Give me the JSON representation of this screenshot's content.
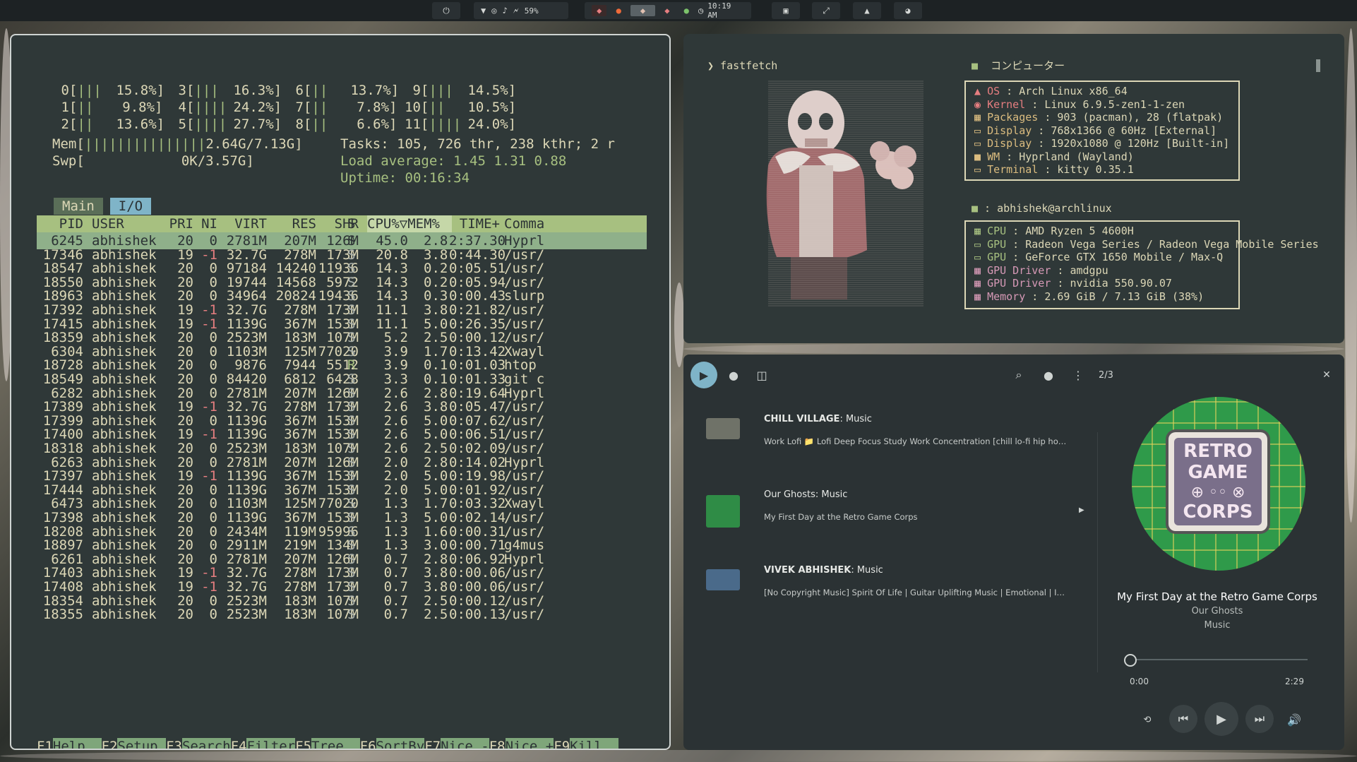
{
  "topbar": {
    "battery": "59%",
    "clock": "10:19 AM"
  },
  "htop": {
    "cpus": [
      {
        "id": "0",
        "bars": "|||",
        "pct": "15.8%]"
      },
      {
        "id": "1",
        "bars": "||",
        "pct": "9.8%]"
      },
      {
        "id": "2",
        "bars": "||",
        "pct": "13.6%]"
      },
      {
        "id": "3",
        "bars": "|||",
        "pct": "16.3%]"
      },
      {
        "id": "4",
        "bars": "||||",
        "pct": "24.2%]"
      },
      {
        "id": "5",
        "bars": "||||",
        "pct": "27.7%]"
      },
      {
        "id": "6",
        "bars": "||",
        "pct": "13.7%]"
      },
      {
        "id": "7",
        "bars": "||",
        "pct": "7.8%]"
      },
      {
        "id": "8",
        "bars": "||",
        "pct": "6.6%]"
      },
      {
        "id": "9",
        "bars": "|||",
        "pct": "14.5%]"
      },
      {
        "id": "10",
        "bars": "||",
        "pct": "10.5%]"
      },
      {
        "id": "11",
        "bars": "||||",
        "pct": "24.0%]"
      }
    ],
    "mem": {
      "label": "Mem[",
      "bars": "|||||||||||||||",
      "value": "2.64G/7.13G]"
    },
    "swp": {
      "label": "Swp[",
      "value": "0K/3.57G]"
    },
    "tasks": "Tasks: 105, 726 thr, 238 kthr; 2 r",
    "load": "Load average: 1.45 1.31 0.88",
    "uptime": "Uptime: 00:16:34",
    "tabs": [
      "Main",
      "I/O"
    ],
    "headers": [
      "PID",
      "USER",
      "PRI",
      "NI",
      "VIRT",
      "RES",
      "SHR",
      "S",
      "CPU%▽MEM%",
      "TIME+",
      "Comma"
    ],
    "rows": [
      [
        "6245",
        "abhishek",
        "20",
        "0",
        "2781M",
        "207M",
        "126M",
        "S",
        "45.0",
        "2.8",
        "2:37.30",
        "Hyprl"
      ],
      [
        "17346",
        "abhishek",
        "19",
        "-1",
        "32.7G",
        "278M",
        "173M",
        "S",
        "20.8",
        "3.8",
        "0:44.30",
        "/usr/"
      ],
      [
        "18547",
        "abhishek",
        "20",
        "0",
        "97184",
        "14240",
        "11936",
        "S",
        "14.3",
        "0.2",
        "0:05.51",
        "/usr/"
      ],
      [
        "18550",
        "abhishek",
        "20",
        "0",
        "19744",
        "14568",
        "5972",
        "S",
        "14.3",
        "0.2",
        "0:05.94",
        "/usr/"
      ],
      [
        "18963",
        "abhishek",
        "20",
        "0",
        "34964",
        "20824",
        "19436",
        "S",
        "14.3",
        "0.3",
        "0:00.43",
        "slurp"
      ],
      [
        "17392",
        "abhishek",
        "19",
        "-1",
        "32.7G",
        "278M",
        "173M",
        "S",
        "11.1",
        "3.8",
        "0:21.82",
        "/usr/"
      ],
      [
        "17415",
        "abhishek",
        "19",
        "-1",
        "1139G",
        "367M",
        "153M",
        "S",
        "11.1",
        "5.0",
        "0:26.35",
        "/usr/"
      ],
      [
        "18359",
        "abhishek",
        "20",
        "0",
        "2523M",
        "183M",
        "107M",
        "S",
        "5.2",
        "2.5",
        "0:00.12",
        "/usr/"
      ],
      [
        "6304",
        "abhishek",
        "20",
        "0",
        "1103M",
        "125M",
        "77020",
        "S",
        "3.9",
        "1.7",
        "0:13.42",
        "Xwayl"
      ],
      [
        "18728",
        "abhishek",
        "20",
        "0",
        "9876",
        "7944",
        "5512",
        "R",
        "3.9",
        "0.1",
        "0:01.03",
        "htop"
      ],
      [
        "18549",
        "abhishek",
        "20",
        "0",
        "84420",
        "6812",
        "6428",
        "S",
        "3.3",
        "0.1",
        "0:01.33",
        "git c"
      ],
      [
        "6282",
        "abhishek",
        "20",
        "0",
        "2781M",
        "207M",
        "126M",
        "S",
        "2.6",
        "2.8",
        "0:19.64",
        "Hyprl"
      ],
      [
        "17389",
        "abhishek",
        "19",
        "-1",
        "32.7G",
        "278M",
        "173M",
        "S",
        "2.6",
        "3.8",
        "0:05.47",
        "/usr/"
      ],
      [
        "17399",
        "abhishek",
        "20",
        "0",
        "1139G",
        "367M",
        "153M",
        "S",
        "2.6",
        "5.0",
        "0:07.62",
        "/usr/"
      ],
      [
        "17400",
        "abhishek",
        "19",
        "-1",
        "1139G",
        "367M",
        "153M",
        "S",
        "2.6",
        "5.0",
        "0:06.51",
        "/usr/"
      ],
      [
        "18318",
        "abhishek",
        "20",
        "0",
        "2523M",
        "183M",
        "107M",
        "S",
        "2.6",
        "2.5",
        "0:02.09",
        "/usr/"
      ],
      [
        "6263",
        "abhishek",
        "20",
        "0",
        "2781M",
        "207M",
        "126M",
        "S",
        "2.0",
        "2.8",
        "0:14.02",
        "Hyprl"
      ],
      [
        "17397",
        "abhishek",
        "19",
        "-1",
        "1139G",
        "367M",
        "153M",
        "S",
        "2.0",
        "5.0",
        "0:19.98",
        "/usr/"
      ],
      [
        "17444",
        "abhishek",
        "20",
        "0",
        "1139G",
        "367M",
        "153M",
        "S",
        "2.0",
        "5.0",
        "0:01.92",
        "/usr/"
      ],
      [
        "6473",
        "abhishek",
        "20",
        "0",
        "1103M",
        "125M",
        "77020",
        "S",
        "1.3",
        "1.7",
        "0:03.32",
        "Xwayl"
      ],
      [
        "17398",
        "abhishek",
        "20",
        "0",
        "1139G",
        "367M",
        "153M",
        "S",
        "1.3",
        "5.0",
        "0:02.14",
        "/usr/"
      ],
      [
        "18208",
        "abhishek",
        "20",
        "0",
        "2434M",
        "119M",
        "95996",
        "S",
        "1.3",
        "1.6",
        "0:00.31",
        "/usr/"
      ],
      [
        "18897",
        "abhishek",
        "20",
        "0",
        "2911M",
        "219M",
        "134M",
        "S",
        "1.3",
        "3.0",
        "0:00.71",
        "g4mus"
      ],
      [
        "6261",
        "abhishek",
        "20",
        "0",
        "2781M",
        "207M",
        "126M",
        "S",
        "0.7",
        "2.8",
        "0:06.92",
        "Hyprl"
      ],
      [
        "17403",
        "abhishek",
        "19",
        "-1",
        "32.7G",
        "278M",
        "173M",
        "S",
        "0.7",
        "3.8",
        "0:00.06",
        "/usr/"
      ],
      [
        "17408",
        "abhishek",
        "19",
        "-1",
        "32.7G",
        "278M",
        "173M",
        "S",
        "0.7",
        "3.8",
        "0:00.06",
        "/usr/"
      ],
      [
        "18354",
        "abhishek",
        "20",
        "0",
        "2523M",
        "183M",
        "107M",
        "S",
        "0.7",
        "2.5",
        "0:00.12",
        "/usr/"
      ],
      [
        "18355",
        "abhishek",
        "20",
        "0",
        "2523M",
        "183M",
        "107M",
        "S",
        "0.7",
        "2.5",
        "0:00.13",
        "/usr/"
      ]
    ],
    "fkeys": [
      {
        "k": "F1",
        "l": "Help  "
      },
      {
        "k": "F2",
        "l": "Setup "
      },
      {
        "k": "F3",
        "l": "Search"
      },
      {
        "k": "F4",
        "l": "Filter"
      },
      {
        "k": "F5",
        "l": "Tree  "
      },
      {
        "k": "F6",
        "l": "SortBy"
      },
      {
        "k": "F7",
        "l": "Nice -"
      },
      {
        "k": "F8",
        "l": "Nice +"
      },
      {
        "k": "F9",
        "l": "Kill  "
      }
    ]
  },
  "fetch": {
    "prompt": "❯ fastfetch",
    "header1": "コンピューター",
    "sys": [
      {
        "k": "OS",
        "v": " : Arch Linux x86_64",
        "c": "lbl-r"
      },
      {
        "k": "Kernel",
        "v": " : Linux 6.9.5-zen1-1-zen",
        "c": "lbl-r"
      },
      {
        "k": "Packages",
        "v": " : 903 (pacman), 28 (flatpak)",
        "c": "lbl-y"
      },
      {
        "k": "Display",
        "v": " : 768x1366 @ 60Hz [External]",
        "c": "lbl-y"
      },
      {
        "k": "Display",
        "v": " : 1920x1080 @ 120Hz [Built-in]",
        "c": "lbl-y"
      },
      {
        "k": "WM",
        "v": " : Hyprland (Wayland)",
        "c": "lbl-y"
      },
      {
        "k": "Terminal",
        "v": " : kitty 0.35.1",
        "c": "lbl-y"
      }
    ],
    "user": " : abhishek@archlinux",
    "hw": [
      {
        "k": "CPU",
        "v": " : AMD Ryzen 5 4600H",
        "c": "lbl-g"
      },
      {
        "k": "GPU",
        "v": " : Radeon Vega Series / Radeon Vega Mobile Series",
        "c": "lbl-g"
      },
      {
        "k": "GPU",
        "v": " : GeForce GTX 1650 Mobile / Max-Q",
        "c": "lbl-g"
      },
      {
        "k": "GPU Driver",
        "v": " : amdgpu",
        "c": "lbl-p"
      },
      {
        "k": "GPU Driver",
        "v": " : nvidia 550.90.07",
        "c": "lbl-p"
      },
      {
        "k": "Memory",
        "v": " : 2.69 GiB / 7.13 GiB (38%)",
        "c": "lbl-p"
      }
    ]
  },
  "music": {
    "queue_pos": "2/3",
    "queue": [
      {
        "title_bold": "CHILL VILLAGE",
        "title_rest": ": Music",
        "subtitle": "Work Lofi 📁 Lofi Deep Focus Study Work Concentration [chill lo-fi hip hop ..."
      },
      {
        "title_bold": "",
        "title_rest": "Our Ghosts: Music",
        "subtitle": "My First Day at the Retro Game Corps"
      },
      {
        "title_bold": "VIVEK ABHISHEK",
        "title_rest": ": Music",
        "subtitle": "[No Copyright Music] Spirit Of Life | Guitar Uplifting Music | Emotional | Inspi..."
      }
    ],
    "art_text": [
      "RETRO",
      "GAME",
      "CORPS"
    ],
    "now_title": "My First Day at the Retro Game Corps",
    "now_artist": "Our Ghosts",
    "now_album": "Music",
    "time_current": "0:00",
    "time_total": "2:29",
    "progress": 0.0
  }
}
